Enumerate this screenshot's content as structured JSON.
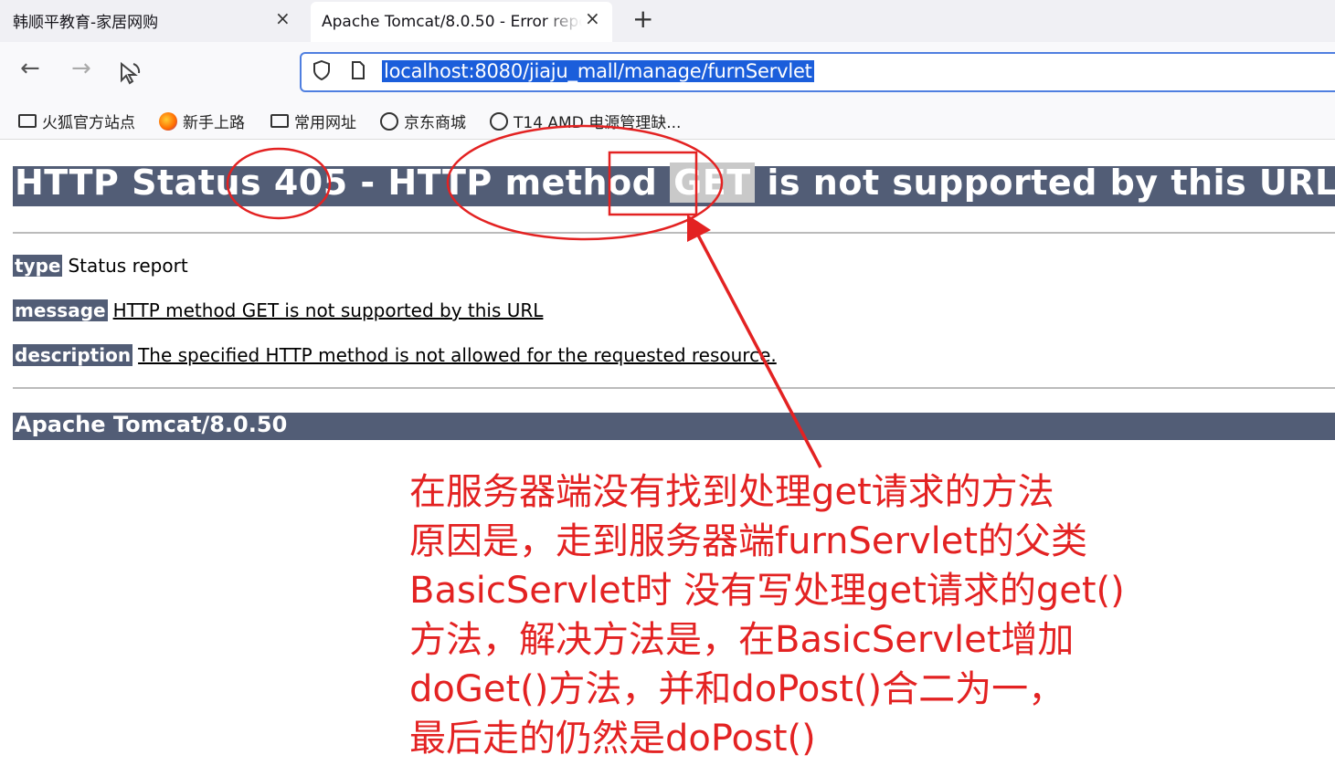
{
  "browser": {
    "tabs": [
      {
        "title": "韩顺平教育-家居网购",
        "close": "×"
      },
      {
        "title": "Apache Tomcat/8.0.50 - Error report",
        "close": "×"
      }
    ],
    "new_tab": "+",
    "nav": {
      "back": "←",
      "forward": "→"
    },
    "url": "localhost:8080/jiaju_mall/manage/furnServlet",
    "bookmarks": [
      {
        "label": "火狐官方站点",
        "icon": "folder-icon"
      },
      {
        "label": "新手上路",
        "icon": "firefox-icon"
      },
      {
        "label": "常用网址",
        "icon": "folder-icon"
      },
      {
        "label": "京东商城",
        "icon": "globe-icon"
      },
      {
        "label": "T14 AMD 电源管理缺...",
        "icon": "globe-icon"
      }
    ]
  },
  "page": {
    "heading_pre": "HTTP Status 405 - HTTP method ",
    "heading_method": "GET",
    "heading_post": " is not supported by this URL",
    "type_label": "type",
    "type_value": "Status report",
    "message_label": "message",
    "message_value": "HTTP method GET is not supported by this URL",
    "description_label": "description",
    "description_value": "The specified HTTP method is not allowed for the requested resource.",
    "footer": "Apache Tomcat/8.0.50"
  },
  "annotation": {
    "color": "#e32222",
    "lines": [
      "在服务器端没有找到处理get请求的方法",
      "原因是，走到服务器端furnServlet的父类",
      "BasicServlet时 没有写处理get请求的get()",
      "方法，解决方法是，在BasicServlet增加",
      "doGet()方法，并和doPost()合二为一，",
      "最后走的仍然是doPost()"
    ]
  }
}
